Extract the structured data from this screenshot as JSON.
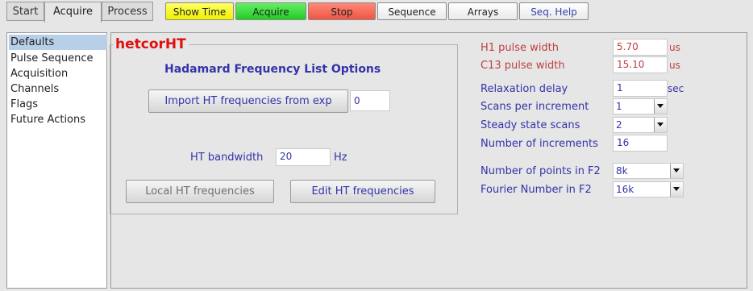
{
  "tabs": [
    "Start",
    "Acquire",
    "Process"
  ],
  "toolbar": {
    "show_time": "Show Time",
    "acquire": "Acquire",
    "stop": "Stop",
    "sequence": "Sequence",
    "arrays": "Arrays",
    "seq_help": "Seq. Help"
  },
  "sidebar": {
    "items": [
      "Defaults",
      "Pulse Sequence",
      "Acquisition",
      "Channels",
      "Flags",
      "Future Actions"
    ]
  },
  "main": {
    "group_title": "hetcorHT",
    "heading": "Hadamard Frequency List Options",
    "import_button": "Import HT frequencies from exp",
    "import_value": "0",
    "bandwidth_label": "HT bandwidth",
    "bandwidth_value": "20",
    "bandwidth_unit": "Hz",
    "local_button": "Local HT frequencies",
    "edit_button": "Edit HT frequencies"
  },
  "params": {
    "h1_label": "H1 pulse width",
    "h1_value": "5.70",
    "h1_unit": "us",
    "c13_label": "C13 pulse width",
    "c13_value": "15.10",
    "c13_unit": "us",
    "relax_label": "Relaxation delay",
    "relax_value": "1",
    "relax_unit": "sec",
    "scans_label": "Scans per increment",
    "scans_value": "1",
    "steady_label": "Steady state scans",
    "steady_value": "2",
    "incr_label": "Number of increments",
    "incr_value": "16",
    "points_label": "Number of points in F2",
    "points_value": "8k",
    "fourier_label": "Fourier Number in F2",
    "fourier_value": "16k"
  },
  "colors": {
    "title_red": "#e01010",
    "label_blue": "#3333aa",
    "label_red": "#c04040",
    "show_time_bg": "#ffff33",
    "acquire_bg": "#33dd33",
    "stop_bg": "#ff6655"
  }
}
